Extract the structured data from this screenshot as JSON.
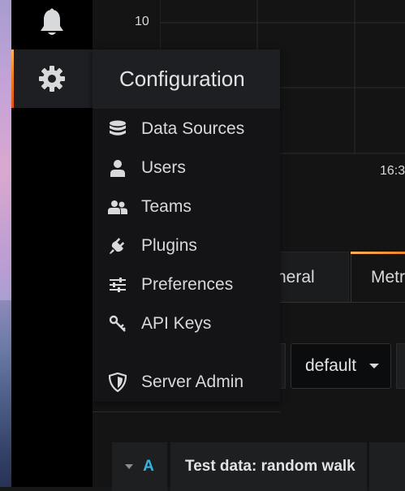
{
  "colors": {
    "accent": "#eb7b18",
    "query_letter": "#33b5e5",
    "menu_bg": "#1e1f22"
  },
  "sidemenu": {
    "alerting_icon": "bell-icon",
    "configuration_icon": "gear-icon"
  },
  "graph": {
    "y_tick": "10",
    "x_tick": "16:3"
  },
  "config_menu": {
    "title": "Configuration",
    "items": [
      {
        "label": "Data Sources",
        "icon": "database-icon"
      },
      {
        "label": "Users",
        "icon": "user-icon"
      },
      {
        "label": "Teams",
        "icon": "users-icon"
      },
      {
        "label": "Plugins",
        "icon": "plug-icon"
      },
      {
        "label": "Preferences",
        "icon": "sliders-icon"
      },
      {
        "label": "API Keys",
        "icon": "key-icon"
      }
    ],
    "admin_item": {
      "label": "Server Admin",
      "icon": "shield-icon"
    }
  },
  "editor": {
    "tabs": [
      {
        "label": "neral"
      },
      {
        "label": "Metr"
      }
    ],
    "datasource": {
      "value": "default"
    },
    "query": {
      "letter": "A",
      "name": "Test data: random walk"
    }
  }
}
